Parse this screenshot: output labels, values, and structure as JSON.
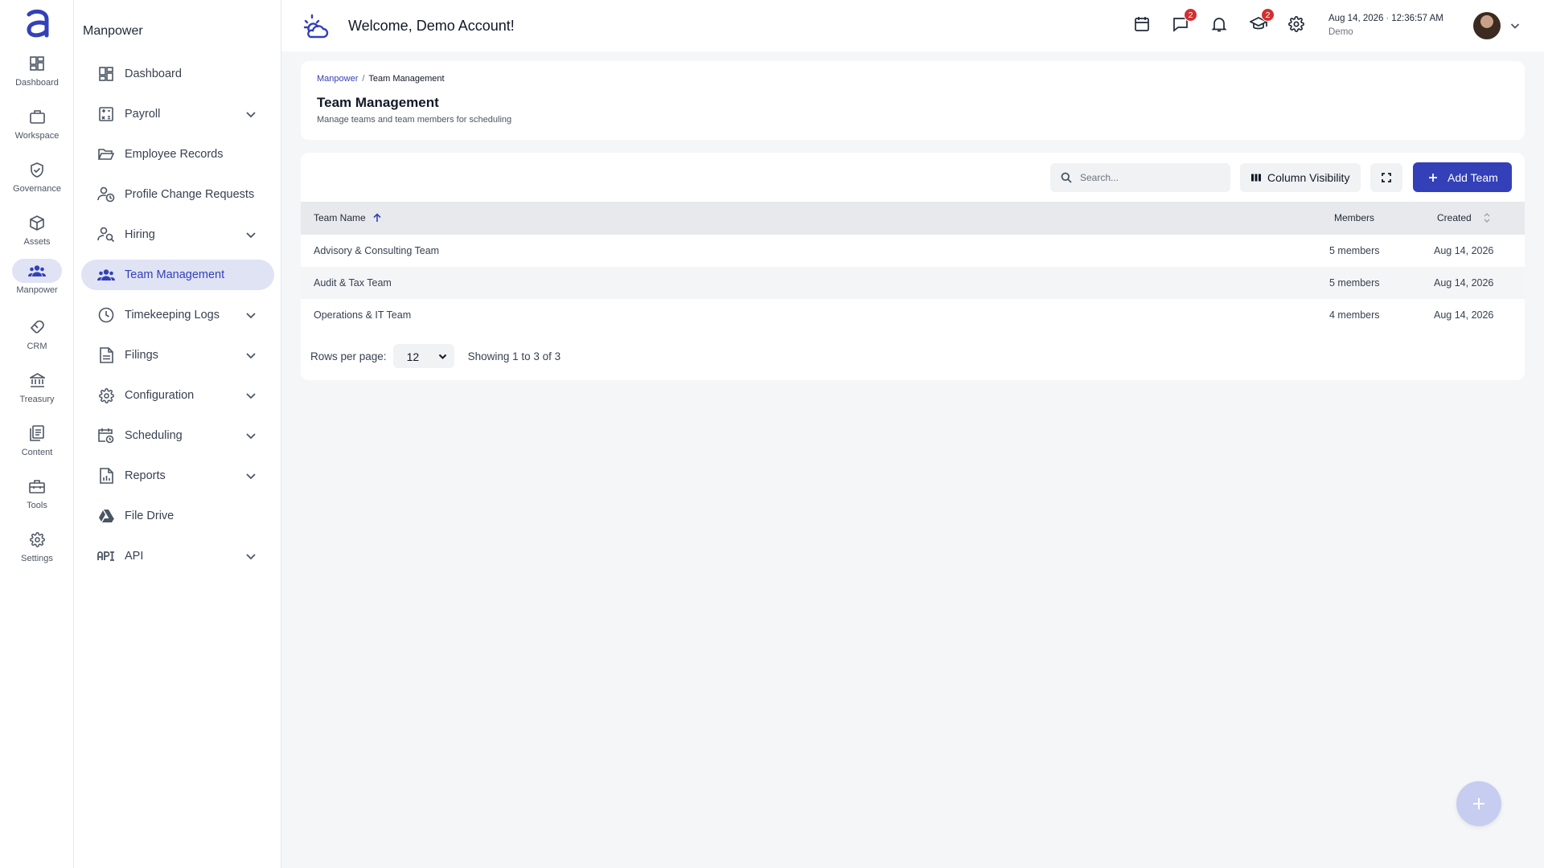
{
  "rail": {
    "items": [
      {
        "label": "Dashboard",
        "icon": "dashboard-icon"
      },
      {
        "label": "Workspace",
        "icon": "briefcase-icon"
      },
      {
        "label": "Governance",
        "icon": "shield-check-icon"
      },
      {
        "label": "Assets",
        "icon": "cube-icon"
      },
      {
        "label": "Manpower",
        "icon": "people-icon",
        "active": true
      },
      {
        "label": "CRM",
        "icon": "handshake-icon"
      },
      {
        "label": "Treasury",
        "icon": "bank-icon"
      },
      {
        "label": "Content",
        "icon": "documents-icon"
      },
      {
        "label": "Tools",
        "icon": "toolbox-icon"
      },
      {
        "label": "Settings",
        "icon": "gear-icon"
      }
    ]
  },
  "sidebar": {
    "title": "Manpower",
    "items": [
      {
        "label": "Dashboard",
        "icon": "dashboard-icon",
        "chevron": false
      },
      {
        "label": "Payroll",
        "icon": "calculator-icon",
        "chevron": true
      },
      {
        "label": "Employee Records",
        "icon": "folder-open-icon",
        "chevron": false
      },
      {
        "label": "Profile Change Requests",
        "icon": "person-clock-icon",
        "chevron": false
      },
      {
        "label": "Hiring",
        "icon": "person-search-icon",
        "chevron": true
      },
      {
        "label": "Team Management",
        "icon": "groups-icon",
        "chevron": false,
        "active": true
      },
      {
        "label": "Timekeeping Logs",
        "icon": "clock-icon",
        "chevron": true
      },
      {
        "label": "Filings",
        "icon": "document-icon",
        "chevron": true
      },
      {
        "label": "Configuration",
        "icon": "gear-icon",
        "chevron": true
      },
      {
        "label": "Scheduling",
        "icon": "calendar-clock-icon",
        "chevron": true
      },
      {
        "label": "Reports",
        "icon": "report-icon",
        "chevron": true
      },
      {
        "label": "File Drive",
        "icon": "drive-icon",
        "chevron": false
      },
      {
        "label": "API",
        "icon": "api-icon",
        "chevron": true
      }
    ]
  },
  "topbar": {
    "welcome": "Welcome, Demo Account!",
    "icons": [
      "calendar-icon",
      "chat-icon",
      "bell-icon",
      "graduation-cap-icon",
      "gear-icon"
    ],
    "chat_badge": "2",
    "learning_badge": "2",
    "date": "Aug 14, 2026",
    "time": "12:36:57 AM",
    "user": "Demo"
  },
  "header": {
    "breadcrumb_parent": "Manpower",
    "breadcrumb_separator": "/",
    "breadcrumb_current": "Team Management",
    "title": "Team Management",
    "subtitle": "Manage teams and team members for scheduling"
  },
  "toolbar": {
    "search_placeholder": "Search...",
    "column_visibility_label": "Column Visibility",
    "add_team_label": "Add Team"
  },
  "table": {
    "columns": [
      "Team Name",
      "Members",
      "Created"
    ],
    "sort": {
      "column": "Team Name",
      "direction": "asc"
    },
    "rows": [
      {
        "name": "Advisory & Consulting Team",
        "members": "5 members",
        "created": "Aug 14, 2026"
      },
      {
        "name": "Audit & Tax Team",
        "members": "5 members",
        "created": "Aug 14, 2026"
      },
      {
        "name": "Operations & IT Team",
        "members": "4 members",
        "created": "Aug 14, 2026"
      }
    ]
  },
  "pagination": {
    "rows_per_page_label": "Rows per page:",
    "rows_per_page_value": "12",
    "showing": "Showing 1 to 3 of 3"
  },
  "colors": {
    "accent": "#3340b8",
    "active_bg": "#dfe3f4",
    "badge": "#d32f2f",
    "fab": "#c7cdf0"
  }
}
